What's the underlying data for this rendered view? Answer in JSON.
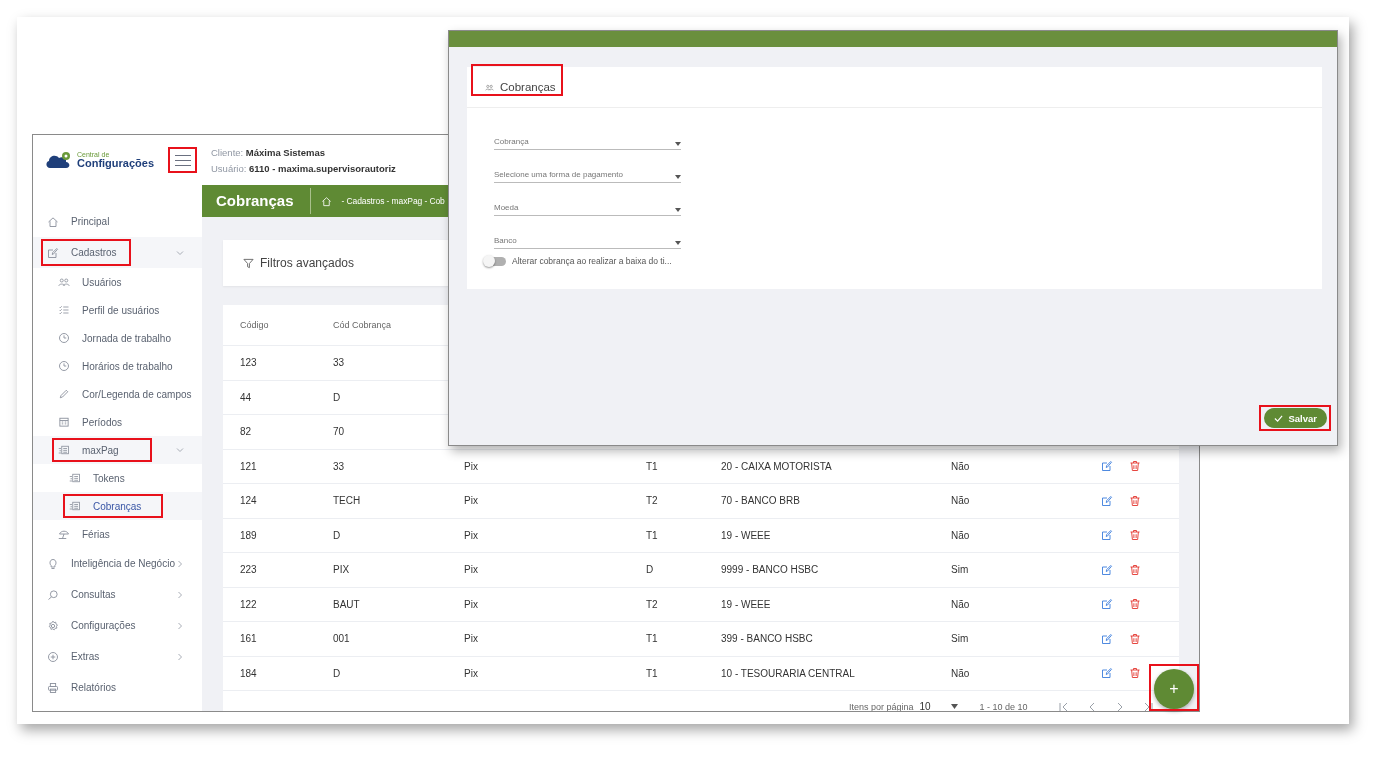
{
  "logo": {
    "line1": "Central de",
    "line2": "Configurações"
  },
  "menu_button": {
    "highlighted": true
  },
  "header": {
    "client": "Cliente: **Máxima Sistemas**",
    "user": "Usuário: **6110 - maxima.supervisorautoriz**"
  },
  "sidebar": {
    "items": [
      {
        "label": "Principal",
        "selected": false
      },
      {
        "label": "Cadastros",
        "selected": false,
        "expanded": true,
        "highlighted": true,
        "children": [
          {
            "label": "Usuários",
            "selected": false
          },
          {
            "label": "Perfil de usuários",
            "selected": false
          },
          {
            "label": "Jornada de trabalho",
            "selected": false
          },
          {
            "label": "Horários de trabalho",
            "selected": false
          },
          {
            "label": "Cor/Legenda de campos",
            "selected": false
          },
          {
            "label": "Períodos",
            "selected": false
          },
          {
            "label": "maxPag",
            "selected": false,
            "expanded": true,
            "highlighted": true,
            "children": [
              {
                "label": "Tokens",
                "selected": false
              },
              {
                "label": "Cobranças",
                "selected": true,
                "highlighted": true
              }
            ]
          },
          {
            "label": "Férias",
            "selected": false
          }
        ]
      },
      {
        "label": "Inteligência de Negócio",
        "selected": false,
        "expanded": false
      },
      {
        "label": "Consultas",
        "selected": false,
        "expanded": false
      },
      {
        "label": "Configurações",
        "selected": false,
        "expanded": false
      },
      {
        "label": "Extras",
        "selected": false,
        "expanded": false
      },
      {
        "label": "Relatórios",
        "selected": false
      }
    ]
  },
  "page": {
    "title": "Cobranças",
    "breadcrumb": "- Cadastros - maxPag - Cob"
  },
  "filters": {
    "label": "Filtros avançados"
  },
  "table": {
    "columns": [
      "Código",
      "Cód Cobrança"
    ],
    "rows": [
      {
        "cells": [
          "123",
          "33"
        ]
      },
      {
        "cells": [
          "44",
          "D"
        ]
      },
      {
        "cells": [
          "82",
          "70"
        ]
      },
      {
        "cells": [
          "121",
          "33",
          "Pix",
          "T1",
          "20 - CAIXA MOTORISTA",
          "Não"
        ]
      },
      {
        "cells": [
          "124",
          "TECH",
          "Pix",
          "T2",
          "70 - BANCO BRB",
          "Não"
        ]
      },
      {
        "cells": [
          "189",
          "D",
          "Pix",
          "T1",
          "19 - WEEE",
          "Não"
        ]
      },
      {
        "cells": [
          "223",
          "PIX",
          "Pix",
          "D",
          "9999 - BANCO HSBC",
          "Sim"
        ]
      },
      {
        "cells": [
          "122",
          "BAUT",
          "Pix",
          "T2",
          "19 - WEEE",
          "Não"
        ]
      },
      {
        "cells": [
          "161",
          "001",
          "Pix",
          "T1",
          "399 - BANCO HSBC",
          "Sim"
        ]
      },
      {
        "cells": [
          "184",
          "D",
          "Pix",
          "T1",
          "10 - TESOURARIA CENTRAL",
          "Não"
        ]
      }
    ]
  },
  "pagination": {
    "items_label": "Itens por página",
    "page_size": "10",
    "range": "1 - 10 de 10"
  },
  "add_button": {
    "label": "+",
    "highlighted": true
  },
  "dialog": {
    "title": "Cobranças",
    "title_highlighted": true,
    "fields": [
      {
        "placeholder": "Cobrança"
      },
      {
        "placeholder": "Selecione uma forma de pagamento"
      },
      {
        "placeholder": "Moeda"
      },
      {
        "placeholder": "Banco"
      }
    ],
    "toggle": {
      "label": "Alterar cobrança ao realizar a baixa do ti...",
      "on": false
    },
    "save_button": {
      "label": "Salvar",
      "highlighted": true
    }
  }
}
